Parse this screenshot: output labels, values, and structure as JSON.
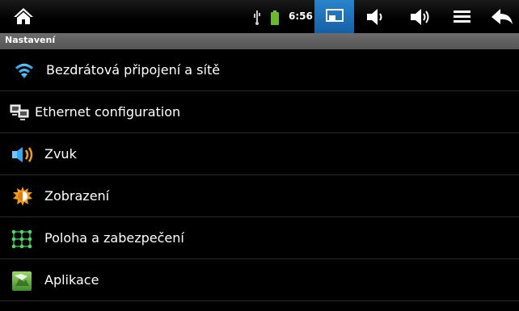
{
  "status_bar": {
    "time": "6:56",
    "icons": [
      "home-icon",
      "usb-icon",
      "battery-icon",
      "screen-icon",
      "volume-down-icon",
      "volume-up-icon",
      "menu-icon",
      "back-icon"
    ],
    "accent_color": "#1f73bd"
  },
  "header": {
    "title": "Nastavení"
  },
  "settings": {
    "items": [
      {
        "label": "Bezdrátová připojení a sítě",
        "icon": "wifi-icon"
      },
      {
        "label": "Ethernet configuration",
        "icon": "ethernet-icon"
      },
      {
        "label": "Zvuk",
        "icon": "speaker-icon"
      },
      {
        "label": "Zobrazení",
        "icon": "brightness-icon"
      },
      {
        "label": "Poloha a zabezpečení",
        "icon": "location-security-icon"
      },
      {
        "label": "Aplikace",
        "icon": "applications-icon"
      }
    ]
  }
}
